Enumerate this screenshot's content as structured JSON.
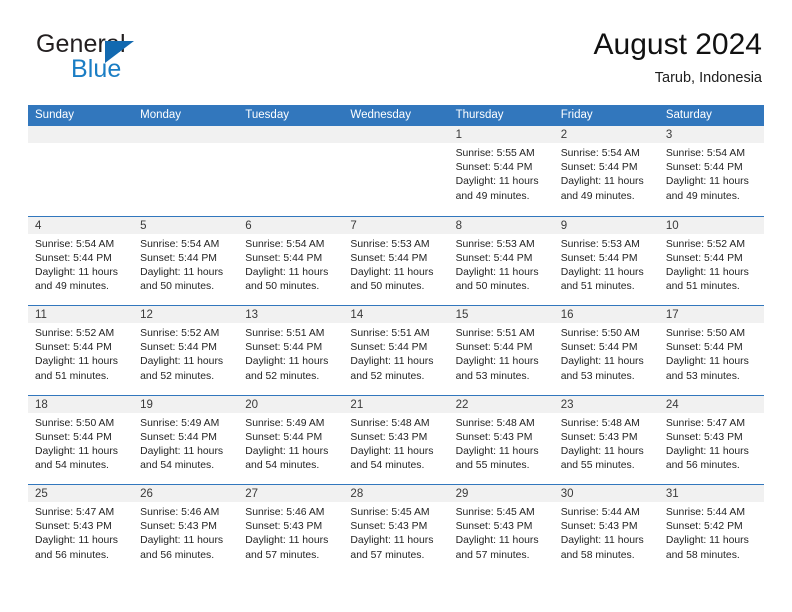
{
  "brand": {
    "word1": "General",
    "word2": "Blue",
    "triangle_color": "#1269b0",
    "blue_color": "#1a7dc4"
  },
  "header": {
    "title": "August 2024",
    "subtitle": "Tarub, Indonesia"
  },
  "colors": {
    "header_blue": "#3277bd",
    "day_band_gray": "#f1f1f1",
    "text": "#242424"
  },
  "weekdays": [
    "Sunday",
    "Monday",
    "Tuesday",
    "Wednesday",
    "Thursday",
    "Friday",
    "Saturday"
  ],
  "weeks": [
    [
      {
        "day": "",
        "sunrise": "",
        "sunset": "",
        "daylight1": "",
        "daylight2": ""
      },
      {
        "day": "",
        "sunrise": "",
        "sunset": "",
        "daylight1": "",
        "daylight2": ""
      },
      {
        "day": "",
        "sunrise": "",
        "sunset": "",
        "daylight1": "",
        "daylight2": ""
      },
      {
        "day": "",
        "sunrise": "",
        "sunset": "",
        "daylight1": "",
        "daylight2": ""
      },
      {
        "day": "1",
        "sunrise": "Sunrise: 5:55 AM",
        "sunset": "Sunset: 5:44 PM",
        "daylight1": "Daylight: 11 hours",
        "daylight2": "and 49 minutes."
      },
      {
        "day": "2",
        "sunrise": "Sunrise: 5:54 AM",
        "sunset": "Sunset: 5:44 PM",
        "daylight1": "Daylight: 11 hours",
        "daylight2": "and 49 minutes."
      },
      {
        "day": "3",
        "sunrise": "Sunrise: 5:54 AM",
        "sunset": "Sunset: 5:44 PM",
        "daylight1": "Daylight: 11 hours",
        "daylight2": "and 49 minutes."
      }
    ],
    [
      {
        "day": "4",
        "sunrise": "Sunrise: 5:54 AM",
        "sunset": "Sunset: 5:44 PM",
        "daylight1": "Daylight: 11 hours",
        "daylight2": "and 49 minutes."
      },
      {
        "day": "5",
        "sunrise": "Sunrise: 5:54 AM",
        "sunset": "Sunset: 5:44 PM",
        "daylight1": "Daylight: 11 hours",
        "daylight2": "and 50 minutes."
      },
      {
        "day": "6",
        "sunrise": "Sunrise: 5:54 AM",
        "sunset": "Sunset: 5:44 PM",
        "daylight1": "Daylight: 11 hours",
        "daylight2": "and 50 minutes."
      },
      {
        "day": "7",
        "sunrise": "Sunrise: 5:53 AM",
        "sunset": "Sunset: 5:44 PM",
        "daylight1": "Daylight: 11 hours",
        "daylight2": "and 50 minutes."
      },
      {
        "day": "8",
        "sunrise": "Sunrise: 5:53 AM",
        "sunset": "Sunset: 5:44 PM",
        "daylight1": "Daylight: 11 hours",
        "daylight2": "and 50 minutes."
      },
      {
        "day": "9",
        "sunrise": "Sunrise: 5:53 AM",
        "sunset": "Sunset: 5:44 PM",
        "daylight1": "Daylight: 11 hours",
        "daylight2": "and 51 minutes."
      },
      {
        "day": "10",
        "sunrise": "Sunrise: 5:52 AM",
        "sunset": "Sunset: 5:44 PM",
        "daylight1": "Daylight: 11 hours",
        "daylight2": "and 51 minutes."
      }
    ],
    [
      {
        "day": "11",
        "sunrise": "Sunrise: 5:52 AM",
        "sunset": "Sunset: 5:44 PM",
        "daylight1": "Daylight: 11 hours",
        "daylight2": "and 51 minutes."
      },
      {
        "day": "12",
        "sunrise": "Sunrise: 5:52 AM",
        "sunset": "Sunset: 5:44 PM",
        "daylight1": "Daylight: 11 hours",
        "daylight2": "and 52 minutes."
      },
      {
        "day": "13",
        "sunrise": "Sunrise: 5:51 AM",
        "sunset": "Sunset: 5:44 PM",
        "daylight1": "Daylight: 11 hours",
        "daylight2": "and 52 minutes."
      },
      {
        "day": "14",
        "sunrise": "Sunrise: 5:51 AM",
        "sunset": "Sunset: 5:44 PM",
        "daylight1": "Daylight: 11 hours",
        "daylight2": "and 52 minutes."
      },
      {
        "day": "15",
        "sunrise": "Sunrise: 5:51 AM",
        "sunset": "Sunset: 5:44 PM",
        "daylight1": "Daylight: 11 hours",
        "daylight2": "and 53 minutes."
      },
      {
        "day": "16",
        "sunrise": "Sunrise: 5:50 AM",
        "sunset": "Sunset: 5:44 PM",
        "daylight1": "Daylight: 11 hours",
        "daylight2": "and 53 minutes."
      },
      {
        "day": "17",
        "sunrise": "Sunrise: 5:50 AM",
        "sunset": "Sunset: 5:44 PM",
        "daylight1": "Daylight: 11 hours",
        "daylight2": "and 53 minutes."
      }
    ],
    [
      {
        "day": "18",
        "sunrise": "Sunrise: 5:50 AM",
        "sunset": "Sunset: 5:44 PM",
        "daylight1": "Daylight: 11 hours",
        "daylight2": "and 54 minutes."
      },
      {
        "day": "19",
        "sunrise": "Sunrise: 5:49 AM",
        "sunset": "Sunset: 5:44 PM",
        "daylight1": "Daylight: 11 hours",
        "daylight2": "and 54 minutes."
      },
      {
        "day": "20",
        "sunrise": "Sunrise: 5:49 AM",
        "sunset": "Sunset: 5:44 PM",
        "daylight1": "Daylight: 11 hours",
        "daylight2": "and 54 minutes."
      },
      {
        "day": "21",
        "sunrise": "Sunrise: 5:48 AM",
        "sunset": "Sunset: 5:43 PM",
        "daylight1": "Daylight: 11 hours",
        "daylight2": "and 54 minutes."
      },
      {
        "day": "22",
        "sunrise": "Sunrise: 5:48 AM",
        "sunset": "Sunset: 5:43 PM",
        "daylight1": "Daylight: 11 hours",
        "daylight2": "and 55 minutes."
      },
      {
        "day": "23",
        "sunrise": "Sunrise: 5:48 AM",
        "sunset": "Sunset: 5:43 PM",
        "daylight1": "Daylight: 11 hours",
        "daylight2": "and 55 minutes."
      },
      {
        "day": "24",
        "sunrise": "Sunrise: 5:47 AM",
        "sunset": "Sunset: 5:43 PM",
        "daylight1": "Daylight: 11 hours",
        "daylight2": "and 56 minutes."
      }
    ],
    [
      {
        "day": "25",
        "sunrise": "Sunrise: 5:47 AM",
        "sunset": "Sunset: 5:43 PM",
        "daylight1": "Daylight: 11 hours",
        "daylight2": "and 56 minutes."
      },
      {
        "day": "26",
        "sunrise": "Sunrise: 5:46 AM",
        "sunset": "Sunset: 5:43 PM",
        "daylight1": "Daylight: 11 hours",
        "daylight2": "and 56 minutes."
      },
      {
        "day": "27",
        "sunrise": "Sunrise: 5:46 AM",
        "sunset": "Sunset: 5:43 PM",
        "daylight1": "Daylight: 11 hours",
        "daylight2": "and 57 minutes."
      },
      {
        "day": "28",
        "sunrise": "Sunrise: 5:45 AM",
        "sunset": "Sunset: 5:43 PM",
        "daylight1": "Daylight: 11 hours",
        "daylight2": "and 57 minutes."
      },
      {
        "day": "29",
        "sunrise": "Sunrise: 5:45 AM",
        "sunset": "Sunset: 5:43 PM",
        "daylight1": "Daylight: 11 hours",
        "daylight2": "and 57 minutes."
      },
      {
        "day": "30",
        "sunrise": "Sunrise: 5:44 AM",
        "sunset": "Sunset: 5:43 PM",
        "daylight1": "Daylight: 11 hours",
        "daylight2": "and 58 minutes."
      },
      {
        "day": "31",
        "sunrise": "Sunrise: 5:44 AM",
        "sunset": "Sunset: 5:42 PM",
        "daylight1": "Daylight: 11 hours",
        "daylight2": "and 58 minutes."
      }
    ]
  ]
}
